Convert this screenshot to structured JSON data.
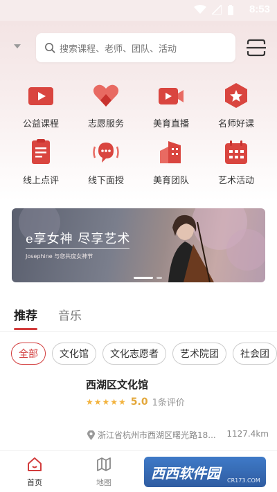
{
  "status_bar": {
    "time": "8:53"
  },
  "search": {
    "placeholder": "搜索课程、老师、团队、活动"
  },
  "categories": [
    {
      "label": "公益课程",
      "icon": "play-video-icon"
    },
    {
      "label": "志愿服务",
      "icon": "heart-icon"
    },
    {
      "label": "美育直播",
      "icon": "live-camera-icon"
    },
    {
      "label": "名师好课",
      "icon": "star-badge-icon"
    },
    {
      "label": "线上点评",
      "icon": "document-icon"
    },
    {
      "label": "线下面授",
      "icon": "chat-bubble-icon"
    },
    {
      "label": "美育团队",
      "icon": "building-icon"
    },
    {
      "label": "艺术活动",
      "icon": "calendar-icon"
    }
  ],
  "banner": {
    "headline": "e享女神 尽享艺术",
    "subline": "Josephine 与您共度女神节"
  },
  "tabs": [
    {
      "label": "推荐",
      "active": true
    },
    {
      "label": "音乐",
      "active": false
    }
  ],
  "filters": [
    {
      "label": "全部",
      "active": true
    },
    {
      "label": "文化馆",
      "active": false
    },
    {
      "label": "文化志愿者",
      "active": false
    },
    {
      "label": "艺术院团",
      "active": false
    },
    {
      "label": "社会团",
      "active": false
    }
  ],
  "venue": {
    "name": "西湖区文化馆",
    "stars": "★★★★★",
    "score": "5.0",
    "reviews": "1条评价",
    "address": "浙江省杭州市西湖区曙光路18...",
    "distance": "1127.4km"
  },
  "bottom_nav": [
    {
      "label": "首页",
      "icon": "home-icon",
      "active": true
    },
    {
      "label": "地图",
      "icon": "map-icon",
      "active": false
    }
  ],
  "watermark": {
    "brand": "西西软件园",
    "url": "CR173.COM"
  },
  "colors": {
    "accent": "#d23c3c",
    "star": "#f2b23c",
    "icon_red": "#d9453f"
  }
}
